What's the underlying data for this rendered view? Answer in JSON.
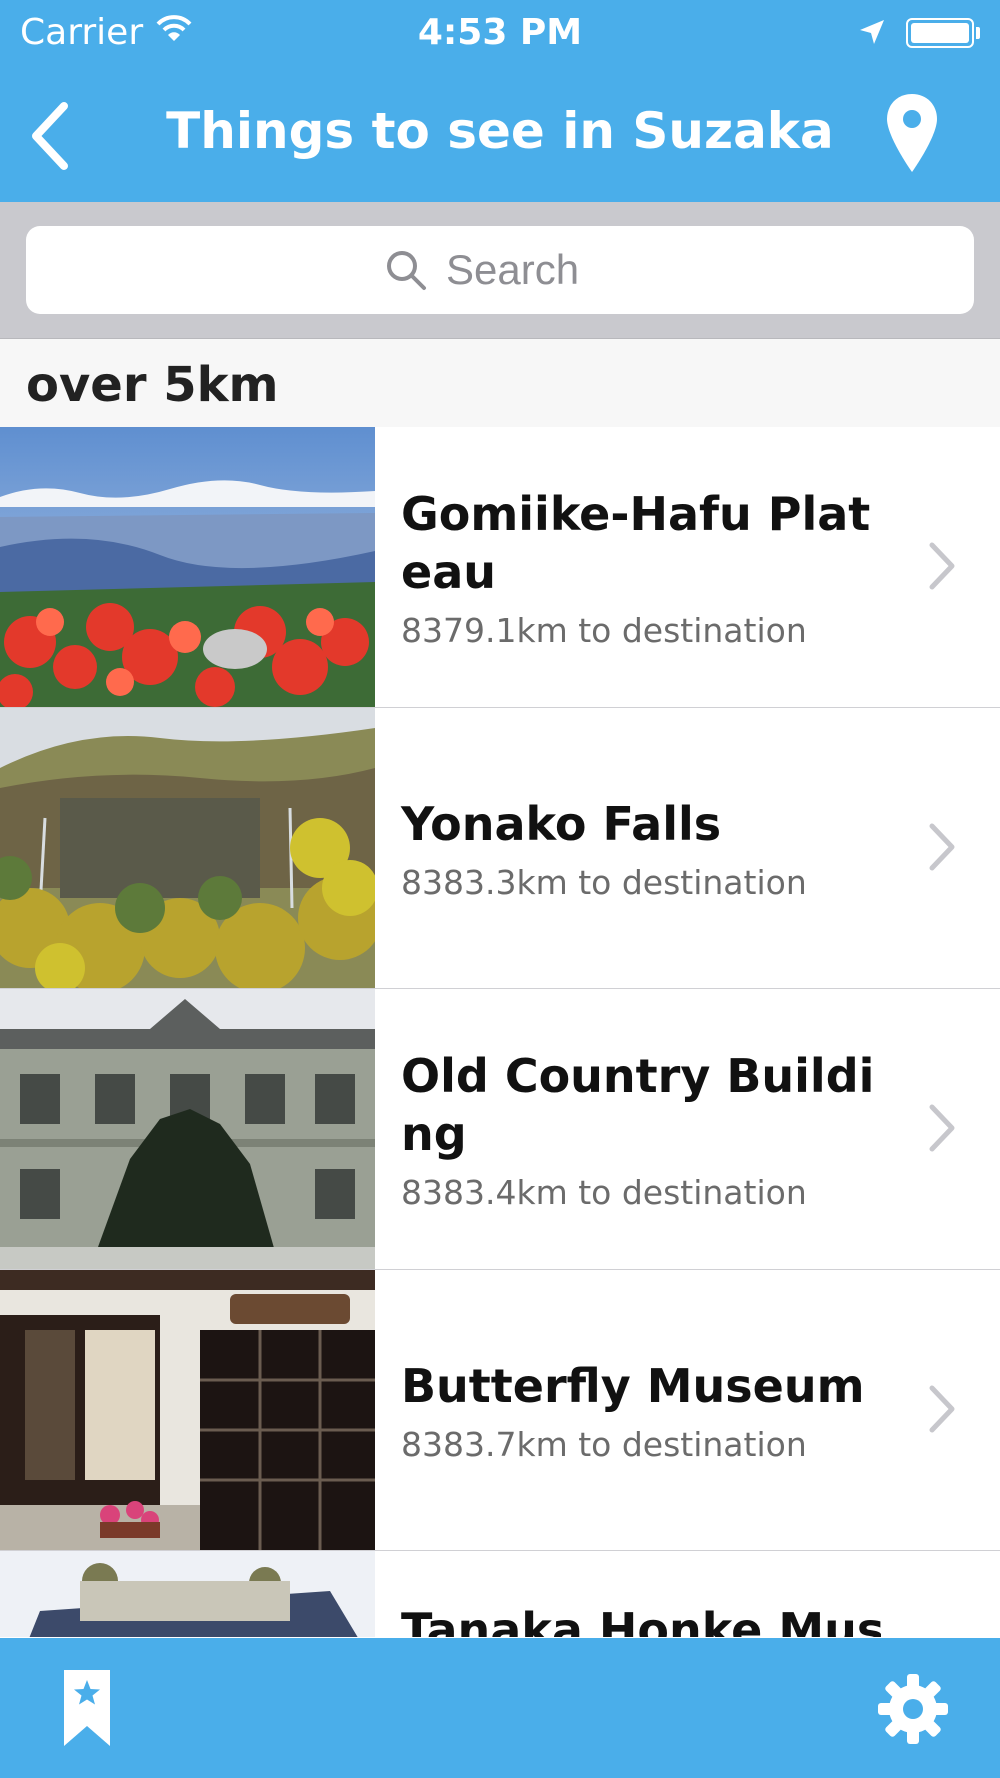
{
  "status_bar": {
    "carrier": "Carrier",
    "time": "4:53 PM",
    "icons": [
      "wifi-icon",
      "location-arrow-icon",
      "battery-icon"
    ]
  },
  "nav_bar": {
    "title": "Things to see in Suzaka",
    "left_icon": "back-chevron-icon",
    "right_icon": "map-pin-icon"
  },
  "search": {
    "placeholder": "Search",
    "value": ""
  },
  "section": {
    "header": "over 5km"
  },
  "places": [
    {
      "name": "Gomiike-Hafu Plateau",
      "distance": "8379.1km to destination",
      "image": "mountain-azalea-landscape"
    },
    {
      "name": "Yonako Falls",
      "distance": "8383.3km to destination",
      "image": "autumn-cliff-waterfall"
    },
    {
      "name": "Old Country Building",
      "distance": "8383.4km to destination",
      "image": "western-style-building"
    },
    {
      "name": "Butterfly Museum",
      "distance": "8383.7km to destination",
      "image": "museum-storefront"
    },
    {
      "name": "Tanaka Honke Museum",
      "distance": "",
      "image": "temple-roof"
    }
  ],
  "tab_bar": {
    "left_icon": "bookmark-star-icon",
    "right_icon": "gear-icon"
  },
  "colors": {
    "accent": "#4aaeea",
    "search_bg": "#c9c9ce",
    "section_bg": "#f7f7f7",
    "chevron": "#c7c7cc",
    "secondary_text": "#6b6b6b"
  }
}
